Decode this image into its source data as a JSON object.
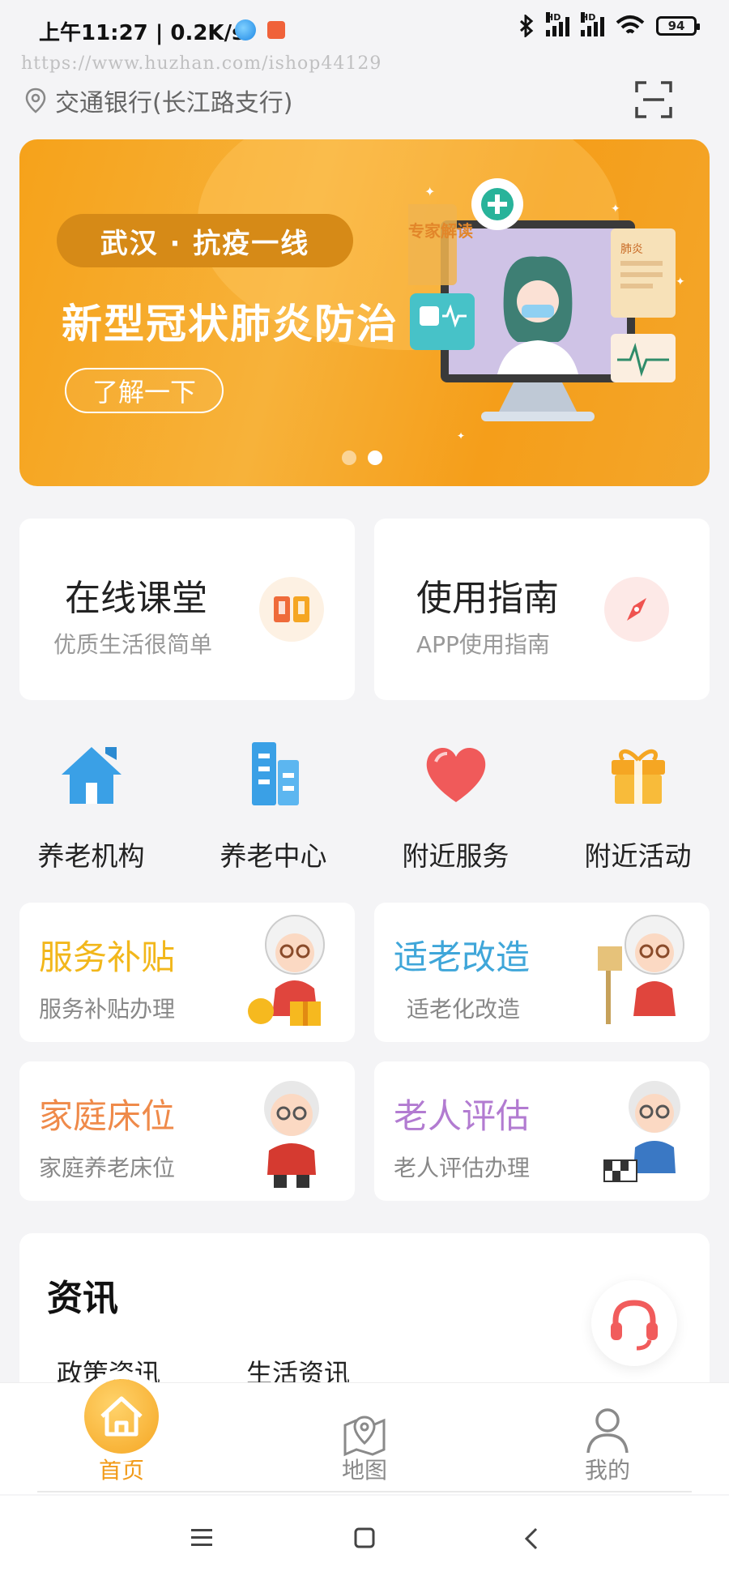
{
  "status_bar": {
    "time": "上午11:27 | 0.2K/s",
    "battery": "94",
    "signal_hd_1": "HD",
    "signal_hd_2": "HD"
  },
  "watermark": "https://www.huzhan.com/ishop44129",
  "location": {
    "text": "交通银行(长江路支行)"
  },
  "banner": {
    "tag": "武汉 · 抗疫一线",
    "title": "新型冠状肺炎防治",
    "button": "了解一下",
    "illustration_doc_badge": "专家解读",
    "illustration_report_label": "肺炎",
    "pages": 2,
    "active_page": 2
  },
  "feature_cards": [
    {
      "title": "在线课堂",
      "subtitle": "优质生活很简单",
      "icon": "book-icon"
    },
    {
      "title": "使用指南",
      "subtitle": "APP使用指南",
      "icon": "compass-icon"
    }
  ],
  "quick_links": [
    {
      "label": "养老机构",
      "icon": "house-icon"
    },
    {
      "label": "养老中心",
      "icon": "building-icon"
    },
    {
      "label": "附近服务",
      "icon": "heart-icon"
    },
    {
      "label": "附近活动",
      "icon": "gift-icon"
    }
  ],
  "services": [
    {
      "title": "服务补贴",
      "subtitle": "服务补贴办理",
      "color": "#f2b71b"
    },
    {
      "title": "适老改造",
      "subtitle": "适老化改造",
      "color": "#3fa6d9"
    },
    {
      "title": "家庭床位",
      "subtitle": "家庭养老床位",
      "color": "#ef8a4a"
    },
    {
      "title": "老人评估",
      "subtitle": "老人评估办理",
      "color": "#b27bd1"
    }
  ],
  "news": {
    "title": "资讯",
    "tabs": [
      "政策资讯",
      "生活资讯"
    ]
  },
  "tab_bar": {
    "items": [
      {
        "label": "首页",
        "icon": "home-icon",
        "active": true
      },
      {
        "label": "地图",
        "icon": "map-pin-icon",
        "active": false
      },
      {
        "label": "我的",
        "icon": "user-icon",
        "active": false
      }
    ]
  },
  "colors": {
    "accent": "#f5a623",
    "banner": "#f6a21a",
    "background": "#f4f4f6"
  }
}
